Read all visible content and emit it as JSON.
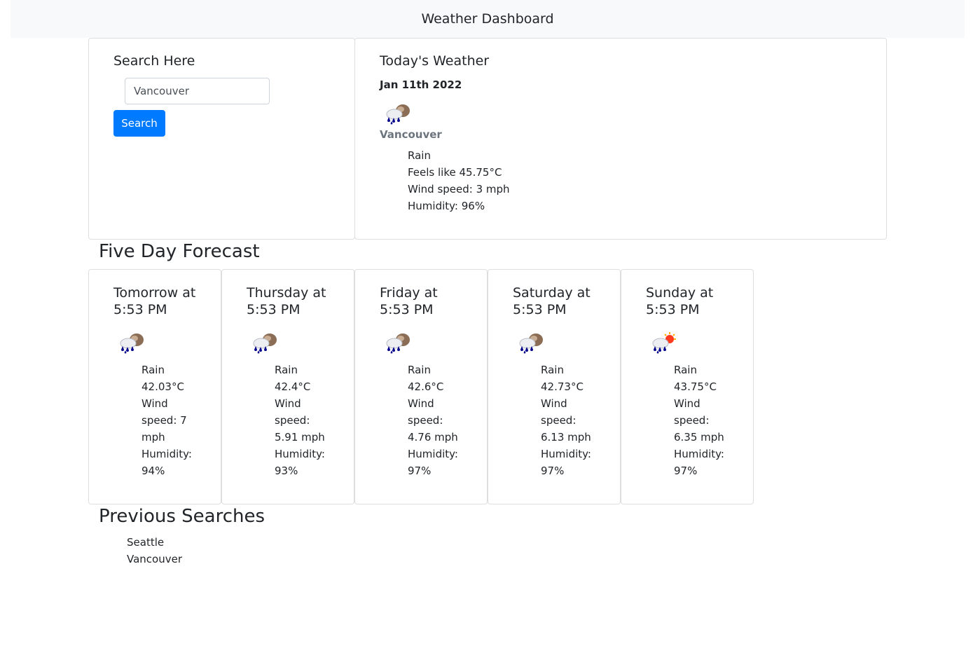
{
  "navbar": {
    "title": "Weather Dashboard"
  },
  "search": {
    "title": "Search Here",
    "input_value": "Vancouver",
    "button_label": "Search"
  },
  "today": {
    "title": "Today's Weather",
    "date": "Jan 11th 2022",
    "icon": "rain-cloud-icon",
    "city": "Vancouver",
    "condition": "Rain",
    "feels_like": "Feels like 45.75°C",
    "wind": "Wind speed: 3 mph",
    "humidity": "Humidity: 96%"
  },
  "forecast": {
    "title": "Five Day Forecast",
    "days": [
      {
        "day": "Tomorrow at",
        "time": "5:53 PM",
        "icon": "rain-cloud-icon",
        "lines": [
          "Rain",
          "42.03°C",
          "Wind",
          "speed: 7",
          "mph",
          "Humidity:",
          "94%"
        ]
      },
      {
        "day": "Thursday at",
        "time": "5:53 PM",
        "icon": "rain-cloud-icon",
        "lines": [
          "Rain",
          "42.4°C",
          "Wind",
          "speed:",
          "5.91 mph",
          "Humidity:",
          "93%"
        ]
      },
      {
        "day": "Friday at",
        "time": "5:53 PM",
        "icon": "rain-cloud-icon",
        "lines": [
          "Rain",
          "42.6°C",
          "Wind",
          "speed:",
          "4.76 mph",
          "Humidity:",
          "97%"
        ]
      },
      {
        "day": "Saturday at",
        "time": "5:53 PM",
        "icon": "rain-cloud-icon",
        "lines": [
          "Rain",
          "42.73°C",
          "Wind",
          "speed:",
          "6.13 mph",
          "Humidity:",
          "97%"
        ]
      },
      {
        "day": "Sunday at",
        "time": "5:53 PM",
        "icon": "rain-sun-icon",
        "lines": [
          "Rain",
          "43.75°C",
          "Wind",
          "speed:",
          "6.35 mph",
          "Humidity:",
          "97%"
        ]
      }
    ]
  },
  "previous": {
    "title": "Previous Searches",
    "items": [
      "Seattle",
      "Vancouver"
    ]
  },
  "colors": {
    "primary": "#007bff",
    "navbar_bg": "#f8f9fa",
    "muted": "#6c757d",
    "text": "#212529"
  }
}
